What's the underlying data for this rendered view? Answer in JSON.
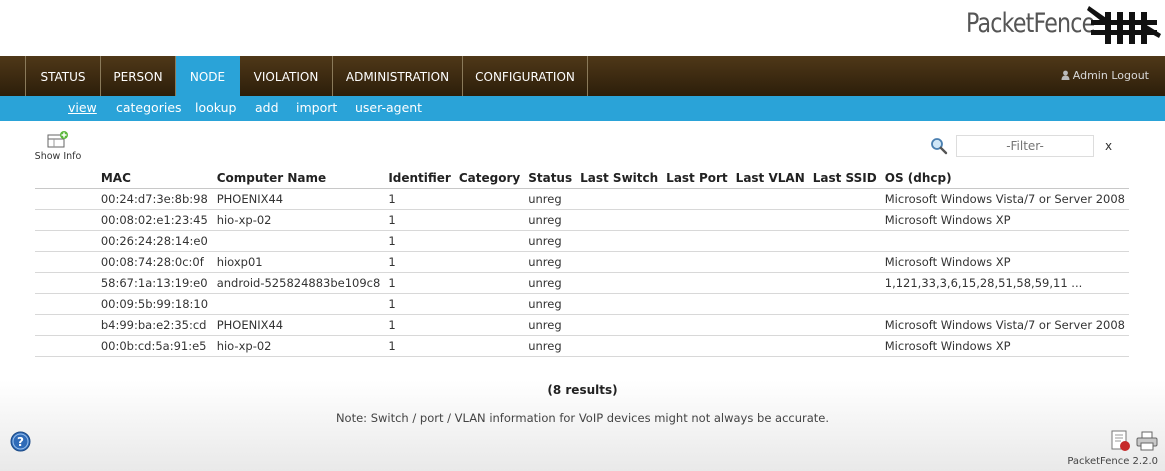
{
  "logo": {
    "text": "PacketFence",
    "icon": "packetfence-logo-icon"
  },
  "nav": {
    "tabs": [
      {
        "label": "STATUS",
        "active": false
      },
      {
        "label": "PERSON",
        "active": false
      },
      {
        "label": "NODE",
        "active": true
      },
      {
        "label": "VIOLATION",
        "active": false
      },
      {
        "label": "ADMINISTRATION",
        "active": false
      },
      {
        "label": "CONFIGURATION",
        "active": false
      }
    ],
    "logout": "Admin Logout"
  },
  "subnav": {
    "items": [
      {
        "label": "view",
        "active": true
      },
      {
        "label": "categories",
        "active": false
      },
      {
        "label": "lookup",
        "active": false
      },
      {
        "label": "add",
        "active": false
      },
      {
        "label": "import",
        "active": false
      },
      {
        "label": "user-agent",
        "active": false
      }
    ]
  },
  "toolbar": {
    "show_info": "Show Info",
    "filter_placeholder": "-Filter-",
    "filter_clear": "x"
  },
  "table": {
    "columns": [
      "MAC",
      "Computer Name",
      "Identifier",
      "Category",
      "Status",
      "Last Switch",
      "Last Port",
      "Last VLAN",
      "Last SSID",
      "OS (dhcp)"
    ],
    "rows": [
      [
        "00:24:d7:3e:8b:98",
        "PHOENIX44",
        "1",
        "",
        "unreg",
        "",
        "",
        "",
        "",
        "Microsoft Windows Vista/7 or Server 2008"
      ],
      [
        "00:08:02:e1:23:45",
        "hio-xp-02",
        "1",
        "",
        "unreg",
        "",
        "",
        "",
        "",
        "Microsoft Windows XP"
      ],
      [
        "00:26:24:28:14:e0",
        "",
        "1",
        "",
        "unreg",
        "",
        "",
        "",
        "",
        ""
      ],
      [
        "00:08:74:28:0c:0f",
        "hioxp01",
        "1",
        "",
        "unreg",
        "",
        "",
        "",
        "",
        "Microsoft Windows XP"
      ],
      [
        "58:67:1a:13:19:e0",
        "android-525824883be109c8",
        "1",
        "",
        "unreg",
        "",
        "",
        "",
        "",
        "1,121,33,3,6,15,28,51,58,59,11 ..."
      ],
      [
        "00:09:5b:99:18:10",
        "",
        "1",
        "",
        "unreg",
        "",
        "",
        "",
        "",
        ""
      ],
      [
        "b4:99:ba:e2:35:cd",
        "PHOENIX44",
        "1",
        "",
        "unreg",
        "",
        "",
        "",
        "",
        "Microsoft Windows Vista/7 or Server 2008"
      ],
      [
        "00:0b:cd:5a:91:e5",
        "hio-xp-02",
        "1",
        "",
        "unreg",
        "",
        "",
        "",
        "",
        "Microsoft Windows XP"
      ]
    ]
  },
  "results": "(8 results)",
  "note": "Note: Switch / port / VLAN information for VoIP devices might not always be accurate.",
  "footer": {
    "version": "PacketFence 2.2.0"
  },
  "colors": {
    "nav_brown": "#3e2b12",
    "accent_blue": "#2aa3d8"
  }
}
